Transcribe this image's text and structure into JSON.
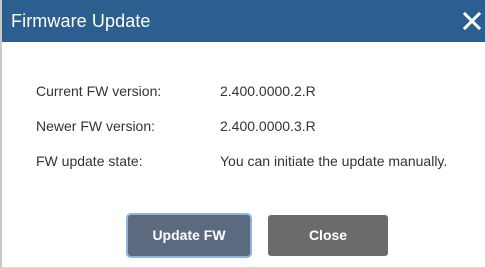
{
  "dialog": {
    "title": "Firmware Update",
    "close_icon": "close-icon"
  },
  "info": {
    "rows": [
      {
        "label": "Current FW version:",
        "value": "2.400.0000.2.R"
      },
      {
        "label": "Newer FW version:",
        "value": "2.400.0000.3.R"
      },
      {
        "label": "FW update state:",
        "value": "You can initiate the update manually."
      }
    ]
  },
  "buttons": {
    "update_label": "Update FW",
    "close_label": "Close"
  },
  "colors": {
    "titlebar": "#2b5f8f",
    "update_button": "#5b6a7e",
    "close_button": "#6b6b6b",
    "focus_ring": "#8fb4dc"
  }
}
